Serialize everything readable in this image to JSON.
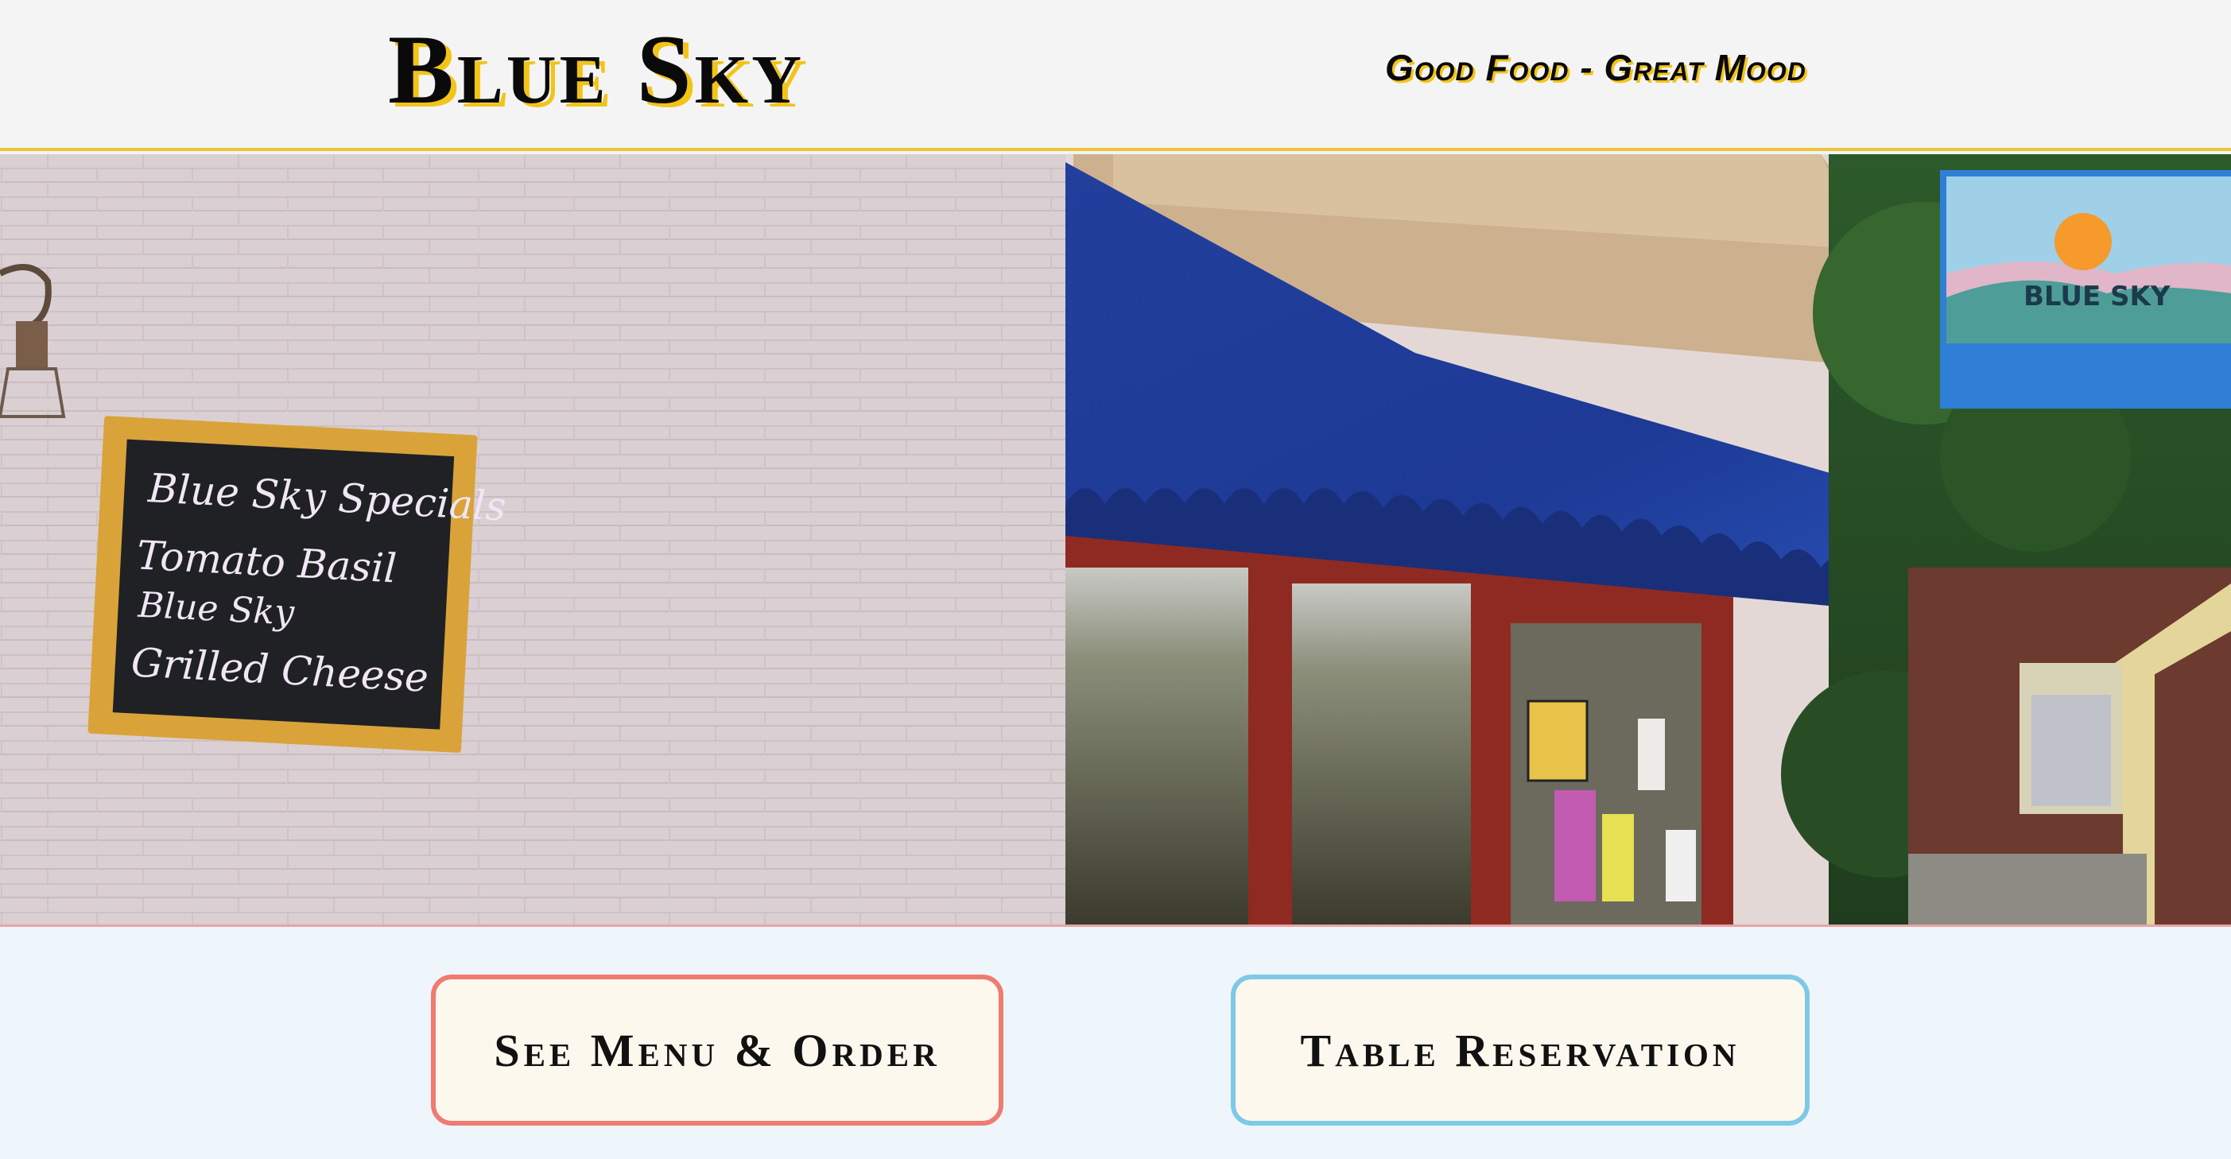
{
  "header": {
    "brand": "Blue Sky",
    "tagline": "Good Food - Great Mood"
  },
  "hero": {
    "chalkboard_lines": [
      "Blue Sky Specials",
      "Tomato Basil",
      "Blue Sky",
      "Grilled Cheese"
    ],
    "hanging_sign": "BLUE SKY"
  },
  "actions": {
    "menu_label": "See Menu & Order",
    "reservation_label": "Table Reservation"
  },
  "colors": {
    "accent_yellow": "#f2c417",
    "menu_border": "#ef7b71",
    "reservation_border": "#7ec9e6",
    "awning_blue": "#1f3fa2"
  }
}
